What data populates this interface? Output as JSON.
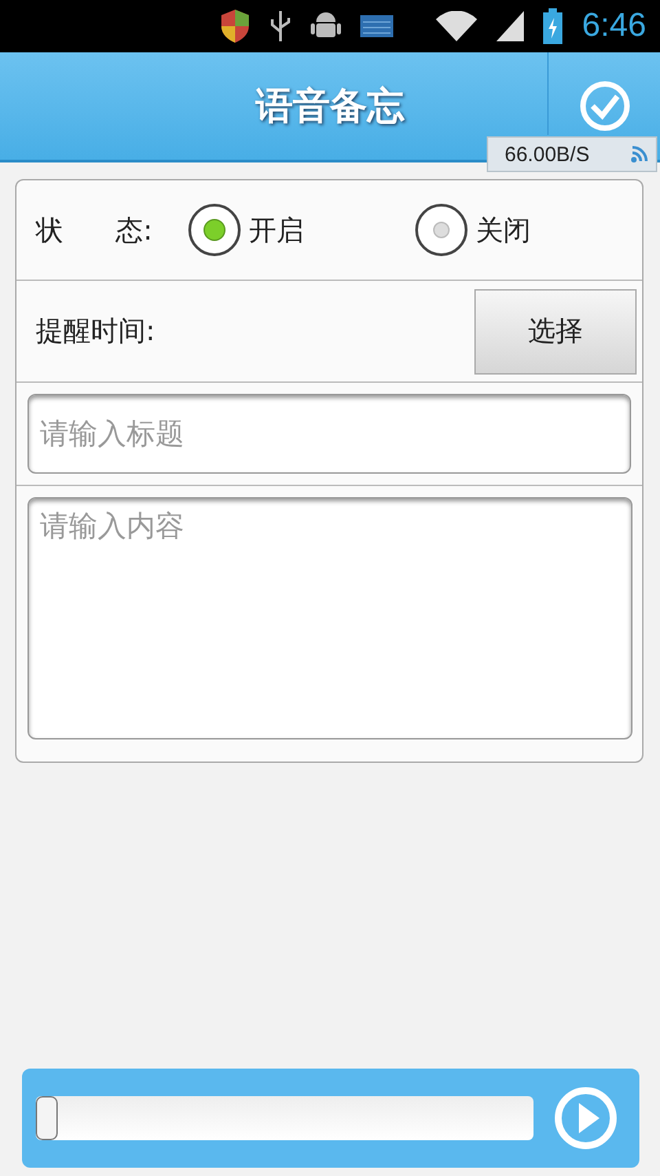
{
  "status_bar": {
    "time": "6:46"
  },
  "header": {
    "title": "语音备忘",
    "speed": "66.00B/S"
  },
  "form": {
    "status_label": "状      态:",
    "status_options": [
      {
        "label": "开启",
        "selected": true
      },
      {
        "label": "关闭",
        "selected": false
      }
    ],
    "reminder_label": "提醒时间:",
    "choose_button": "选择",
    "title_field": {
      "placeholder": "请输入标题"
    },
    "content_field": {
      "placeholder": "请输入内容"
    }
  },
  "player": {
    "level": 0
  }
}
